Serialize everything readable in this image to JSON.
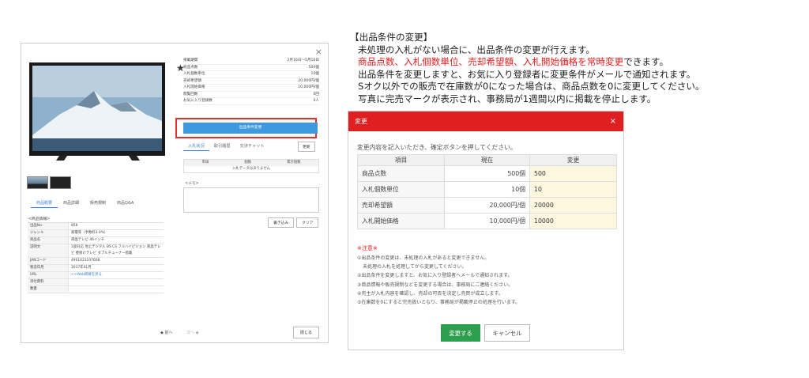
{
  "left_panel": {
    "close": "×",
    "info_rows": [
      {
        "label": "掲載期間",
        "value": "2月16日～5月16日"
      },
      {
        "label": "商品点数",
        "value": "500個"
      },
      {
        "label": "入札個数単位",
        "value": "10個"
      },
      {
        "label": "売却希望額",
        "value": "20,000円/個"
      },
      {
        "label": "入札開始価格",
        "value": "10,000円/個"
      },
      {
        "label": "閲覧回数",
        "value": "0回"
      },
      {
        "label": "お気に入り登録数",
        "value": "0人"
      }
    ],
    "condition_button": "出品条件変更",
    "bid_tabs": [
      "入札状況",
      "取引履歴",
      "交渉チャット"
    ],
    "refresh": "更新",
    "bid_table_headers": [
      "単価",
      "個数",
      "累計個数"
    ],
    "bid_empty": "入札データはありません",
    "memo_label": "<メモ>",
    "memo_write": "書き込み",
    "memo_clear": "クリア",
    "detail_tabs": [
      "商品概要",
      "商品詳細",
      "販売規制",
      "商品Q&A"
    ],
    "product_info_title": "<商品情報>",
    "product_info": [
      {
        "k": "出品No",
        "v": "856"
      },
      {
        "k": "ジャンル",
        "v": "家電等（手数料3.0%）"
      },
      {
        "k": "商品名",
        "v": "液晶テレビ 46インチ"
      },
      {
        "k": "説明文",
        "v": "3波対応 地上デジタル BS CS フルハイビジョン 液晶テレビ 壁掛けテレビ ダブルチューナー搭載"
      },
      {
        "k": "JANコード",
        "v": "4901023107668"
      },
      {
        "k": "製造年月",
        "v": "2017年01月"
      },
      {
        "k": "URL",
        "v": ">>Web掲載を見る"
      },
      {
        "k": "添付資料",
        "v": ""
      },
      {
        "k": "数量",
        "v": ""
      }
    ],
    "nav_prev": "◆ 前へ",
    "nav_next": "次へ ◆",
    "close_button": "閉じる"
  },
  "description": {
    "title": "【出品条件の変更】",
    "line1": "未処理の入札がない場合に、出品条件の変更が行えます。",
    "line2_red": "商品点数、入札個数単位、売却希望額、入札開始価格を常時変更",
    "line2_rest": "できます。",
    "line3": "出品条件を変更しますと、お気に入り登録者に変更条件がメールで通知されます。",
    "line4": "Sオク以外での販売で在庫数が0になった場合は、商品点数を0に変更してください。",
    "line5": "写真に完売マークが表示され、事務局が1週間以内に掲載を停止します。"
  },
  "dialog": {
    "title": "変更",
    "close": "×",
    "intro": "変更内容を記入いただき、確定ボタンを押してください。",
    "headers": [
      "項目",
      "現在",
      "変更"
    ],
    "rows": [
      {
        "label": "商品点数",
        "current": "500個",
        "new": "500"
      },
      {
        "label": "入札個数単位",
        "current": "10個",
        "new": "10"
      },
      {
        "label": "売却希望額",
        "current": "20,000円/個",
        "new": "20000"
      },
      {
        "label": "入札開始価格",
        "current": "10,000円/個",
        "new": "10000"
      }
    ],
    "notes_title": "※注意※",
    "notes": [
      "①出品条件の変更は、未処理の入札があると変更できません。",
      "未処理の入札を処理してから変更してください。",
      "②出品条件を変更しますと、お気に入り登録者へメールで通知されます。",
      "③商品情報や販売規制などを変更する場合は、事務局にご連絡ください。",
      "④売主が入札内容を確認し、売却の可否を決定し売買が成立します。",
      "⑤在庫数を0にすると完売扱いとなり、事務局が掲載停止の処理を行います。"
    ],
    "confirm": "変更する",
    "cancel": "キャンセル"
  },
  "colors": {
    "accent_red": "#e02020",
    "button_blue": "#3d9ae0",
    "confirm_green": "#2e9e4f",
    "input_bg": "#fdf7df"
  }
}
